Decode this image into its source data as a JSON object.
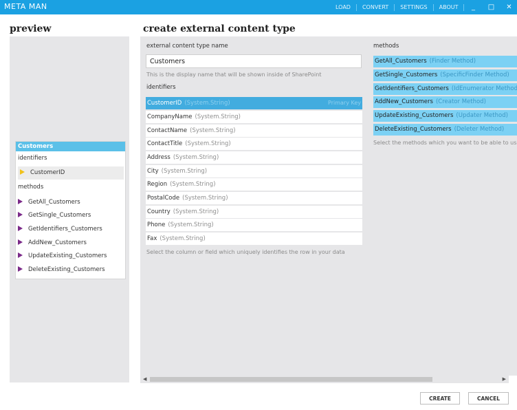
{
  "app": {
    "title": "META MAN",
    "nav": [
      "LOAD",
      "CONVERT",
      "SETTINGS",
      "ABOUT"
    ],
    "window_controls": [
      "_",
      "□",
      "✕"
    ]
  },
  "preview": {
    "heading": "preview",
    "tree": {
      "root": "Customers",
      "identifiers_label": "identifiers",
      "identifiers": [
        "CustomerID"
      ],
      "methods_label": "methods",
      "methods": [
        "GetAll_Customers",
        "GetSingle_Customers",
        "GetIdentifiers_Customers",
        "AddNew_Customers",
        "UpdateExisting_Customers",
        "DeleteExisting_Customers"
      ]
    }
  },
  "main": {
    "heading": "create external content type",
    "name_label": "external content type name",
    "name_value": "Customers",
    "name_hint": "This is the display name that will be shown inside of SharePoint",
    "identifiers_label": "identifiers",
    "identifiers": [
      {
        "name": "CustomerID",
        "type": "(System.String)",
        "tag": "Primary Key"
      },
      {
        "name": "CompanyName",
        "type": "(System.String)"
      },
      {
        "name": "ContactName",
        "type": "(System.String)"
      },
      {
        "name": "ContactTitle",
        "type": "(System.String)"
      },
      {
        "name": "Address",
        "type": "(System.String)"
      },
      {
        "name": "City",
        "type": "(System.String)"
      },
      {
        "name": "Region",
        "type": "(System.String)"
      },
      {
        "name": "PostalCode",
        "type": "(System.String)"
      },
      {
        "name": "Country",
        "type": "(System.String)"
      },
      {
        "name": "Phone",
        "type": "(System.String)"
      },
      {
        "name": "Fax",
        "type": "(System.String)"
      }
    ],
    "identifiers_hint": "Select the column or field which uniquely identifies the row in your data",
    "methods_label": "methods",
    "methods": [
      {
        "name": "GetAll_Customers",
        "type": "(Finder Method)"
      },
      {
        "name": "GetSingle_Customers",
        "type": "(SpecificFinder Method)"
      },
      {
        "name": "GetIdentifiers_Customers",
        "type": "(IdEnumerator Method)"
      },
      {
        "name": "AddNew_Customers",
        "type": "(Creator Method)"
      },
      {
        "name": "UpdateExisting_Customers",
        "type": "(Updater Method)"
      },
      {
        "name": "DeleteExisting_Customers",
        "type": "(Deleter Method)"
      }
    ],
    "methods_hint": "Select the methods which you want to be able to use"
  },
  "footer": {
    "create": "CREATE",
    "cancel": "CANCEL"
  },
  "colors": {
    "titlebar": "#1ba1e2",
    "selected": "#42acdf",
    "method_row": "#7cd1f4",
    "method_icon": "#7b2a89",
    "identifier_icon": "#f1c21b"
  }
}
